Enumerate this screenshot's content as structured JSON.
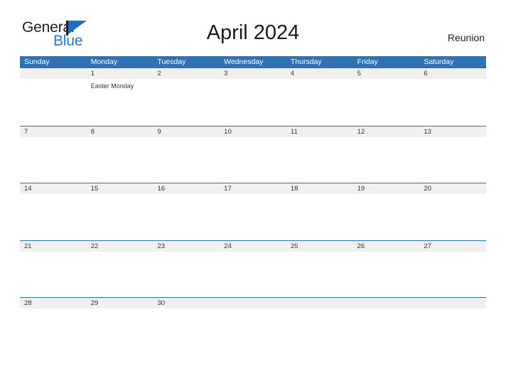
{
  "brand": {
    "name_part1": "General",
    "name_part2": "Blue",
    "mark": "triangle-flag-icon",
    "colors": {
      "dark": "#231f20",
      "blue": "#1b7fd4",
      "mark_blue": "#1f6fc0"
    }
  },
  "header": {
    "title": "April 2024",
    "region": "Reunion"
  },
  "theme": {
    "header_blue": "#2e72b4",
    "band_gray": "#f0f0f0",
    "row_border": "#2e72b4",
    "text": "#333333"
  },
  "calendar": {
    "weekdays": [
      "Sunday",
      "Monday",
      "Tuesday",
      "Wednesday",
      "Thursday",
      "Friday",
      "Saturday"
    ],
    "weeks": [
      [
        {
          "day": "",
          "events": []
        },
        {
          "day": "1",
          "events": [
            "Easter Monday"
          ]
        },
        {
          "day": "2",
          "events": []
        },
        {
          "day": "3",
          "events": []
        },
        {
          "day": "4",
          "events": []
        },
        {
          "day": "5",
          "events": []
        },
        {
          "day": "6",
          "events": []
        }
      ],
      [
        {
          "day": "7",
          "events": []
        },
        {
          "day": "8",
          "events": []
        },
        {
          "day": "9",
          "events": []
        },
        {
          "day": "10",
          "events": []
        },
        {
          "day": "11",
          "events": []
        },
        {
          "day": "12",
          "events": []
        },
        {
          "day": "13",
          "events": []
        }
      ],
      [
        {
          "day": "14",
          "events": []
        },
        {
          "day": "15",
          "events": []
        },
        {
          "day": "16",
          "events": []
        },
        {
          "day": "17",
          "events": []
        },
        {
          "day": "18",
          "events": []
        },
        {
          "day": "19",
          "events": []
        },
        {
          "day": "20",
          "events": []
        }
      ],
      [
        {
          "day": "21",
          "events": []
        },
        {
          "day": "22",
          "events": []
        },
        {
          "day": "23",
          "events": []
        },
        {
          "day": "24",
          "events": []
        },
        {
          "day": "25",
          "events": []
        },
        {
          "day": "26",
          "events": []
        },
        {
          "day": "27",
          "events": []
        }
      ],
      [
        {
          "day": "28",
          "events": []
        },
        {
          "day": "29",
          "events": []
        },
        {
          "day": "30",
          "events": []
        },
        {
          "day": "",
          "events": []
        },
        {
          "day": "",
          "events": []
        },
        {
          "day": "",
          "events": []
        },
        {
          "day": "",
          "events": []
        }
      ]
    ]
  }
}
